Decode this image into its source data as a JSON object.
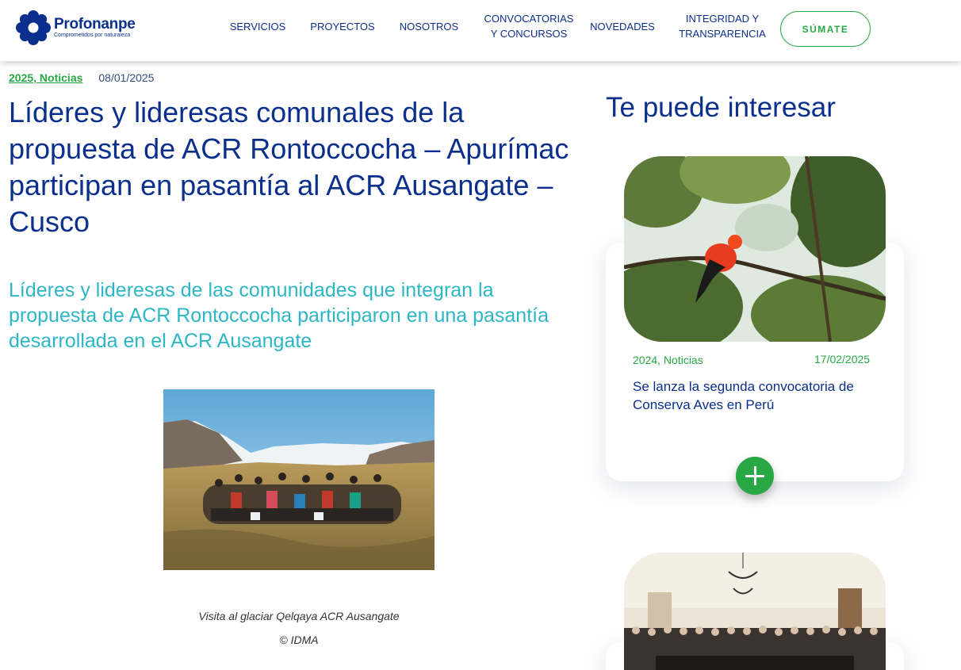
{
  "header": {
    "logo": {
      "name": "Profonanpe",
      "tagline": "Comprometidos por naturaleza"
    },
    "nav": [
      {
        "label": "SERVICIOS"
      },
      {
        "label": "PROYECTOS"
      },
      {
        "label": "NOSOTROS"
      },
      {
        "line1": "CONVOCATORIAS",
        "line2": "Y CONCURSOS"
      },
      {
        "label": "NOVEDADES"
      },
      {
        "line1": "INTEGRIDAD Y",
        "line2": "TRANSPARENCIA"
      }
    ],
    "cta_label": "SÚMATE"
  },
  "article": {
    "category": "2025, Noticias",
    "date": "08/01/2025",
    "title": "Líderes y lideresas comunales de la propuesta de ACR Rontoccocha – Apurímac participan en pasantía al ACR Ausangate – Cusco",
    "subtitle": "Líderes y lideresas de las comunidades que integran la propuesta de ACR Rontoccocha participaron en una pasantía desarrollada en el ACR Ausangate",
    "photo_caption": "Visita al glaciar Qelqaya ACR Ausangate",
    "photo_credit": "© IDMA"
  },
  "sidebar": {
    "title": "Te puede interesar",
    "cards": [
      {
        "category": "2024, Noticias",
        "date": "17/02/2025",
        "title": "Se lanza la segunda convocatoria de Conserva Aves en Perú"
      }
    ]
  },
  "colors": {
    "brand_blue": "#0b2f8c",
    "brand_green": "#27a844",
    "accent_teal": "#2cb6c6"
  }
}
